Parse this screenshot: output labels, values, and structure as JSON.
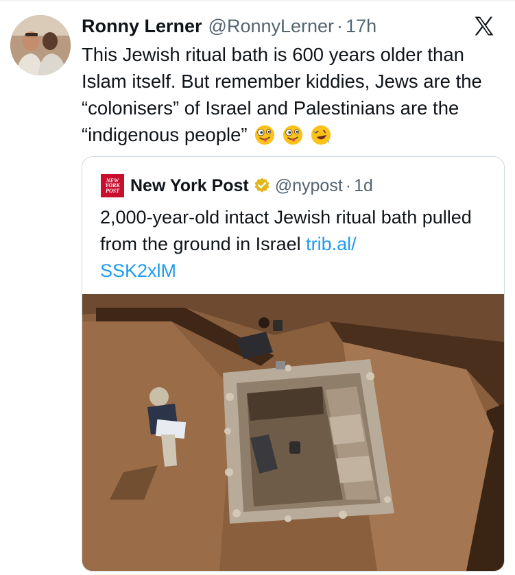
{
  "tweet": {
    "author_name": "Ronny Lerner",
    "handle": "@RonnyLerner",
    "separator": "·",
    "time": "17h",
    "text": "This Jewish ritual bath is 600 years older than Islam itself. But remember kiddies, Jews are the “colonisers” of Israel and Palestinians are the “indigenous people”",
    "emojis": [
      "zany-face-emoji",
      "zany-face-emoji",
      "rolling-on-floor-laughing-emoji"
    ]
  },
  "quoted_tweet": {
    "logo_text": [
      "NEW",
      "YORK",
      "POST"
    ],
    "author_name": "New York Post",
    "handle": "@nypost",
    "separator": "·",
    "time": "1d",
    "text": "2,000-year-old intact Jewish ritual bath pulled from the ground in Israel ",
    "link_part1": "trib.al/",
    "link_part2": "SSK2xlM"
  },
  "icons": {
    "platform": "x-logo-icon",
    "verified": "gold-verified-badge-icon"
  },
  "colors": {
    "link": "#1d9bf0",
    "meta_text": "#536471",
    "nyp_red": "#c8102e",
    "verified_gold": "#e2b719",
    "border": "#cfd9de"
  }
}
